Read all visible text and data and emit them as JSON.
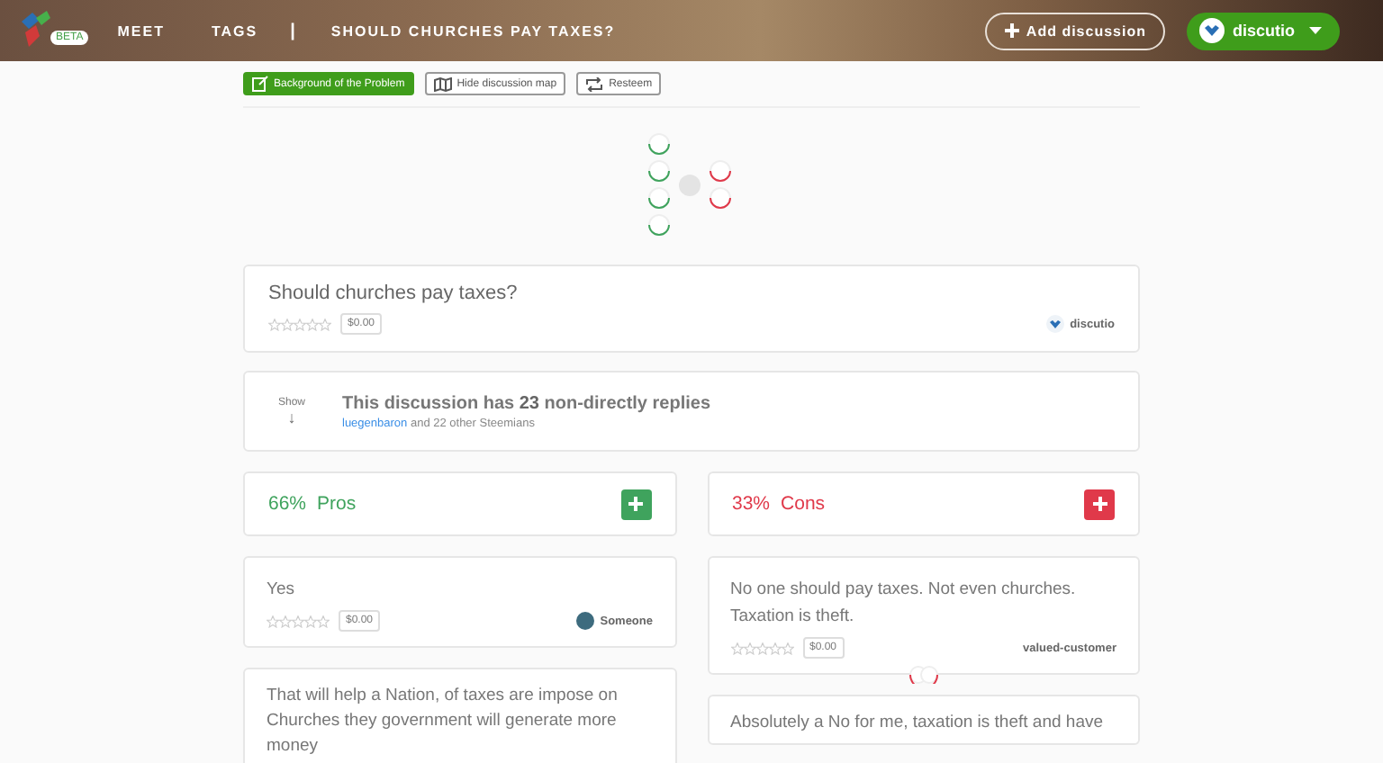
{
  "header": {
    "badge": "BETA",
    "nav": [
      {
        "label": "MEET",
        "kind": "link"
      },
      {
        "label": "TAGS",
        "kind": "link"
      },
      {
        "label": "|",
        "kind": "separator"
      },
      {
        "label": "SHOULD CHURCHES PAY TAXES?",
        "kind": "link"
      }
    ],
    "add_button": "Add discussion",
    "user": "discutio"
  },
  "toolbar": [
    {
      "label": "Background of the Problem",
      "kind": "primary"
    },
    {
      "label": "Hide discussion map",
      "kind": "outline"
    },
    {
      "label": "Resteem",
      "kind": "outline"
    }
  ],
  "map": {
    "nodes": [
      {
        "kind": "pro"
      },
      {
        "kind": "pro"
      },
      {
        "kind": "pro"
      },
      {
        "kind": "pro"
      },
      {
        "kind": "con"
      },
      {
        "kind": "con"
      }
    ]
  },
  "question": {
    "title": "Should churches pay taxes?",
    "stars": 0,
    "payout": "$0.00",
    "author": "discutio"
  },
  "replies": {
    "toggle": "Show",
    "arrow": "↓",
    "summary": "This discussion has **23** non-directly replies",
    "user": "luegenbaron",
    "others": "and 22 other Steemians"
  },
  "columns": [
    {
      "kind": "pro",
      "percent": "66%",
      "label": "Pros",
      "arguments": [
        {
          "text": "Yes",
          "stars": 0,
          "payout": "$0.00",
          "author": "Someone",
          "avatar": true
        },
        {
          "text": "That will help a Nation, of taxes are impose on Churches they government will generate more money"
        }
      ]
    },
    {
      "kind": "con",
      "percent": "33%",
      "label": "Cons",
      "arguments": [
        {
          "text": "No one should pay taxes. Not even churches. Taxation is theft.",
          "stars": 0,
          "payout": "$0.00",
          "author": "valued-customer",
          "avatar": false,
          "subreplies": true
        },
        {
          "text": "Absolutely a No for me, taxation is theft and have"
        }
      ]
    }
  ]
}
